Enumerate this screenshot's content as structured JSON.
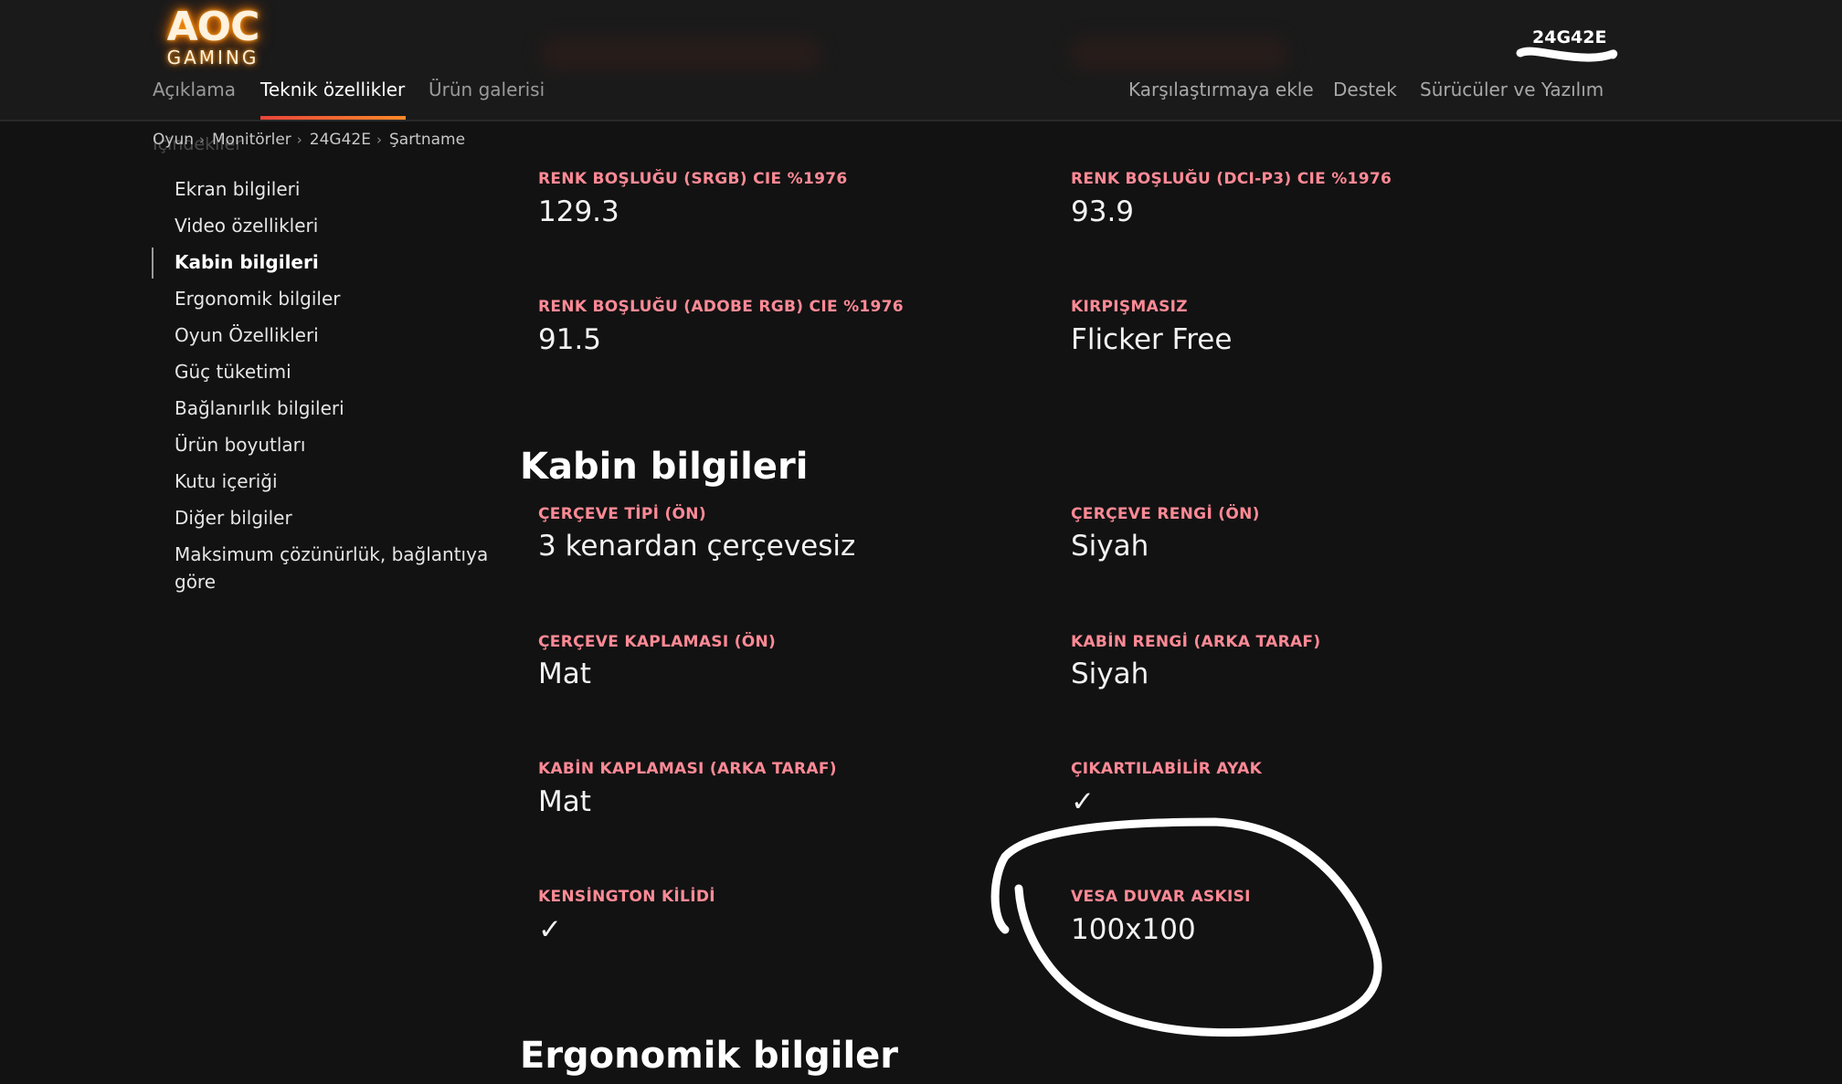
{
  "brand": {
    "line1": "AOC",
    "line2": "GAMING"
  },
  "header": {
    "model": "24G42E",
    "tabs": [
      {
        "label": "Açıklama"
      },
      {
        "label": "Teknik özellikler"
      },
      {
        "label": "Ürün galerisi"
      }
    ],
    "right_links": [
      {
        "label": "Karşılaştırmaya ekle"
      },
      {
        "label": "Destek"
      },
      {
        "label": "Sürücüler ve Yazılım"
      }
    ]
  },
  "breadcrumb": {
    "items": [
      "Oyun",
      "Monitörler",
      "24G42E",
      "Şartname"
    ],
    "overlapped_text": "İçindekiler"
  },
  "sidebar": {
    "items": [
      {
        "label": "Ekran bilgileri"
      },
      {
        "label": "Video özellikleri"
      },
      {
        "label": "Kabin bilgileri"
      },
      {
        "label": "Ergonomik bilgiler"
      },
      {
        "label": "Oyun Özellikleri"
      },
      {
        "label": "Güç tüketimi"
      },
      {
        "label": "Bağlanırlık bilgileri"
      },
      {
        "label": "Ürün boyutları"
      },
      {
        "label": "Kutu içeriği"
      },
      {
        "label": "Diğer bilgiler"
      },
      {
        "label": "Maksimum çözünürlük, bağlantıya göre"
      }
    ],
    "active_index": 2
  },
  "specs_top": [
    {
      "label": "RENK BOŞLUĞU (SRGB) CIE %1976",
      "value": "129.3"
    },
    {
      "label": "RENK BOŞLUĞU (DCI-P3) CIE %1976",
      "value": "93.9"
    },
    {
      "label": "RENK BOŞLUĞU (ADOBE RGB) CIE %1976",
      "value": "91.5"
    },
    {
      "label": "KIRPIŞMASIZ",
      "value": "Flicker Free"
    }
  ],
  "cabinet": {
    "title": "Kabin bilgileri",
    "specs": [
      {
        "label": "ÇERÇEVE TİPİ (ÖN)",
        "value": "3 kenardan çerçevesiz"
      },
      {
        "label": "ÇERÇEVE RENGİ (ÖN)",
        "value": "Siyah"
      },
      {
        "label": "ÇERÇEVE KAPLAMASI (ÖN)",
        "value": "Mat"
      },
      {
        "label": "KABİN RENGİ (ARKA TARAF)",
        "value": "Siyah"
      },
      {
        "label": "KABİN KAPLAMASI (ARKA TARAF)",
        "value": "Mat"
      },
      {
        "label": "ÇIKARTILABİLİR AYAK",
        "value": "✓"
      },
      {
        "label": "KENSİNGTON KİLİDİ",
        "value": "✓"
      },
      {
        "label": "VESA DUVAR ASKISI",
        "value": "100x100"
      }
    ]
  },
  "ergonomic": {
    "title": "Ergonomik bilgiler"
  },
  "annotation_color": "#ffffff",
  "accent_gradient": [
    "#e8453a",
    "#ff8a2a"
  ]
}
